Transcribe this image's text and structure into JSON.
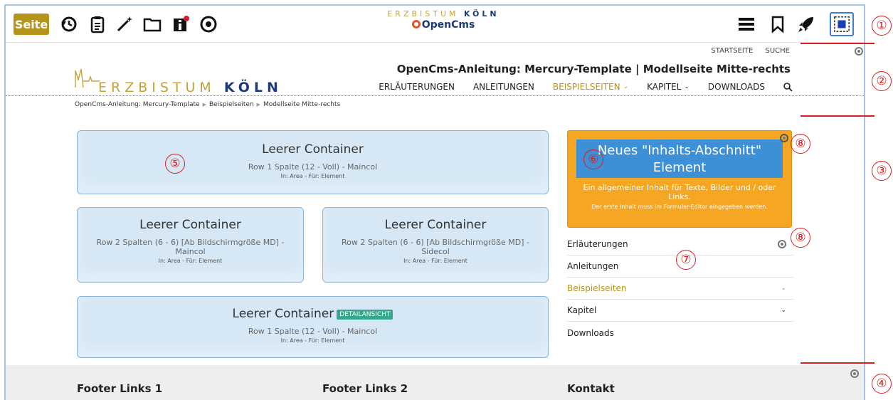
{
  "toolbar": {
    "page_button": "Seite",
    "icons": [
      "history-icon",
      "clipboard-icon",
      "magic-wand-icon",
      "folder-icon",
      "info-icon",
      "target-icon"
    ],
    "brand_line1": "ERZBISTUM",
    "brand_line1b": "KÖLN",
    "brand_line2": "OpenCms",
    "right_icons": [
      "menu-icon",
      "bookmark-icon",
      "rocket-icon",
      "select-area-icon"
    ]
  },
  "header": {
    "utility_links": [
      "STARTSEITE",
      "SUCHE"
    ],
    "site_title": "OpenCms-Anleitung: Mercury-Template | Modellseite Mitte-rechts",
    "logo_text_light": "ERZBISTUM",
    "logo_text_bold": "KÖLN",
    "nav": [
      {
        "label": "ERLÄUTERUNGEN",
        "active": false,
        "dropdown": false
      },
      {
        "label": "ANLEITUNGEN",
        "active": false,
        "dropdown": false
      },
      {
        "label": "BEISPIELSEITEN",
        "active": true,
        "dropdown": true
      },
      {
        "label": "KAPITEL",
        "active": false,
        "dropdown": true
      },
      {
        "label": "DOWNLOADS",
        "active": false,
        "dropdown": false
      }
    ]
  },
  "breadcrumb": [
    "OpenCms-Anleitung: Mercury-Template",
    "Beispielseiten",
    "Modellseite Mitte-rechts"
  ],
  "containers": [
    {
      "title": "Leerer Container",
      "sub": "Row 1 Spalte (12 - Voll) - Maincol",
      "meta": "In: Area - Für: Element"
    },
    {
      "title": "Leerer Container",
      "sub": "Row 2 Spalten (6 - 6) [Ab Bildschirmgröße MD] - Maincol",
      "meta": "In: Area - Für: Element"
    },
    {
      "title": "Leerer Container",
      "sub": "Row 2 Spalten (6 - 6) [Ab Bildschirmgröße MD] - Sidecol",
      "meta": "In: Area - Für: Element"
    },
    {
      "title": "Leerer Container",
      "badge": "DETAILANSICHT",
      "sub": "Row 1 Spalte (12 - Voll) - Maincol",
      "meta": "In: Area - Für: Element"
    }
  ],
  "new_element": {
    "button_label": "Neues \"Inhalts-Abschnitt\" Element",
    "desc1": "Ein allgemeiner Inhalt für Texte, Bilder und / oder Links.",
    "desc2": "Der erste Inhalt muss im Formular-Editor eingegeben werden."
  },
  "sidenav": [
    {
      "label": "Erläuterungen",
      "active": false,
      "chevron": false
    },
    {
      "label": "Anleitungen",
      "active": false,
      "chevron": false
    },
    {
      "label": "Beispielseiten",
      "active": true,
      "chevron": true
    },
    {
      "label": "Kapitel",
      "active": false,
      "chevron": true
    },
    {
      "label": "Downloads",
      "active": false,
      "chevron": false
    }
  ],
  "footer": {
    "col1": "Footer Links 1",
    "col2": "Footer Links 2",
    "col3": "Kontakt"
  },
  "callouts": [
    "①",
    "②",
    "③",
    "④",
    "⑤",
    "⑥",
    "⑦",
    "⑧",
    "⑧"
  ],
  "colors": {
    "accent_gold": "#b5941c",
    "container_blue": "#d6e8f5",
    "orange": "#f5a623",
    "callout_red": "#d92020"
  }
}
